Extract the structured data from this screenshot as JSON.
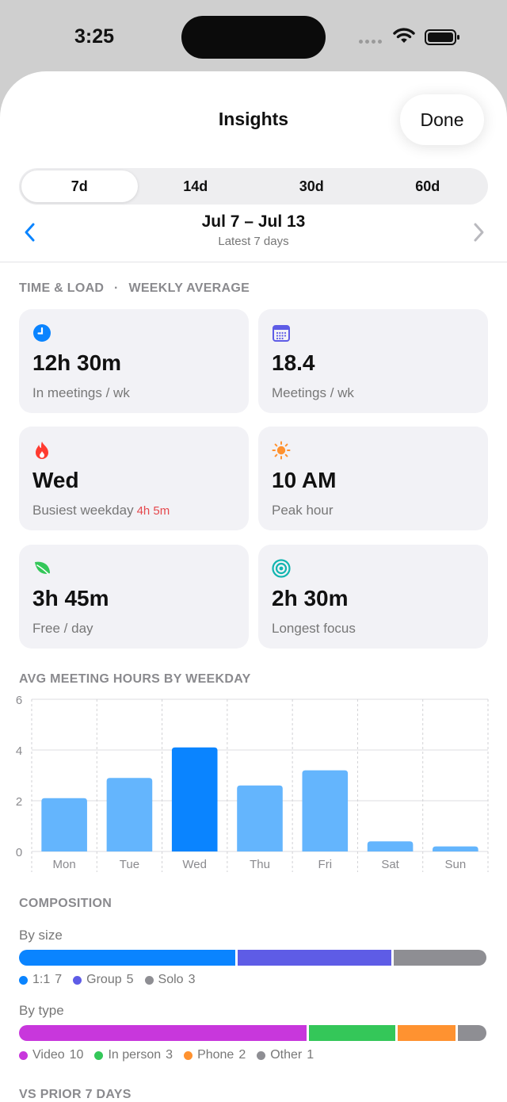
{
  "status": {
    "time": "3:25"
  },
  "header": {
    "title": "Insights",
    "done_label": "Done"
  },
  "segments": [
    {
      "label": "7d",
      "active": true
    },
    {
      "label": "14d",
      "active": false
    },
    {
      "label": "30d",
      "active": false
    },
    {
      "label": "60d",
      "active": false
    }
  ],
  "range": {
    "title": "Jul 7 – Jul 13",
    "subtitle": "Latest 7 days"
  },
  "time_load": {
    "section_label": "TIME & LOAD",
    "separator": "·",
    "section_suffix": "WEEKLY AVERAGE"
  },
  "cards": [
    {
      "icon": "clock-icon",
      "value": "12h 30m",
      "label": "In meetings / wk",
      "accent": ""
    },
    {
      "icon": "calendar-icon",
      "value": "18.4",
      "label": "Meetings / wk",
      "accent": ""
    },
    {
      "icon": "flame-icon",
      "value": "Wed",
      "label": "Busiest weekday",
      "accent": "4h 5m"
    },
    {
      "icon": "sun-icon",
      "value": "10 AM",
      "label": "Peak hour",
      "accent": ""
    },
    {
      "icon": "leaf-icon",
      "value": "3h 45m",
      "label": "Free / day",
      "accent": ""
    },
    {
      "icon": "target-icon",
      "value": "2h 30m",
      "label": "Longest focus",
      "accent": ""
    }
  ],
  "chart_section_label": "AVG MEETING HOURS BY WEEKDAY",
  "chart_data": {
    "type": "bar",
    "categories": [
      "Mon",
      "Tue",
      "Wed",
      "Thu",
      "Fri",
      "Sat",
      "Sun"
    ],
    "values": [
      2.1,
      2.9,
      4.1,
      2.6,
      3.2,
      0.4,
      0.2
    ],
    "highlight": "Wed",
    "ylim": [
      0,
      6
    ],
    "yticks": [
      "0",
      "2",
      "4",
      "6"
    ],
    "grid": true,
    "colors": {
      "bar": "#64b5fd",
      "highlight": "#0a84ff"
    }
  },
  "composition": {
    "section_label": "COMPOSITION",
    "by_size": {
      "label": "By size",
      "segments": [
        {
          "name": "1:1",
          "count": "7",
          "value": 7,
          "color": "#0a84ff"
        },
        {
          "name": "Group",
          "count": "5",
          "value": 5,
          "color": "#5e5ce6"
        },
        {
          "name": "Solo",
          "count": "3",
          "value": 3,
          "color": "#8e8e93"
        }
      ]
    },
    "by_type": {
      "label": "By type",
      "segments": [
        {
          "name": "Video",
          "count": "10",
          "value": 10,
          "color": "#c837dc"
        },
        {
          "name": "In person",
          "count": "3",
          "value": 3,
          "color": "#34c759"
        },
        {
          "name": "Phone",
          "count": "2",
          "value": 2,
          "color": "#ff9230"
        },
        {
          "name": "Other",
          "count": "1",
          "value": 1,
          "color": "#8e8e93"
        }
      ]
    }
  },
  "vs_prior_label": "VS PRIOR 7 DAYS"
}
